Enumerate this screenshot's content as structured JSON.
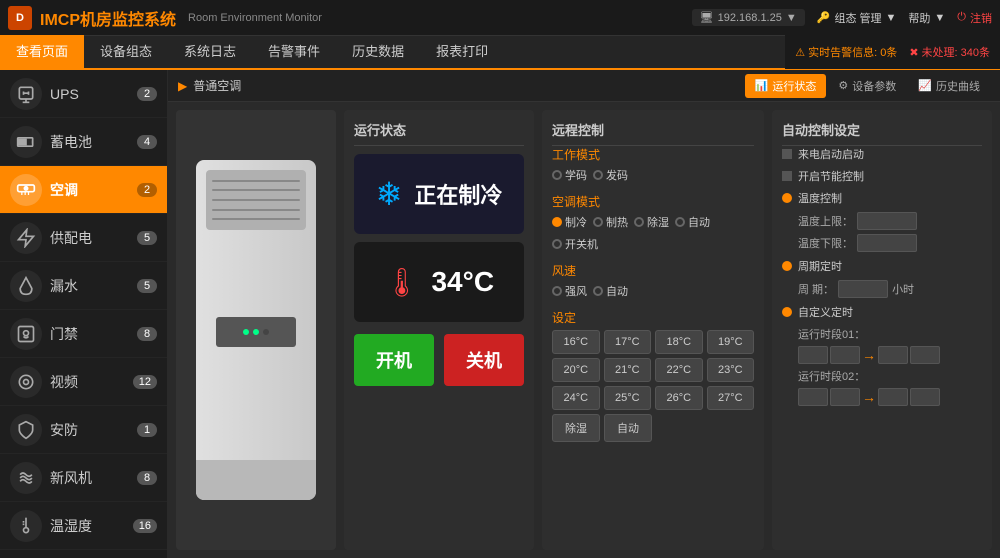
{
  "header": {
    "logo_icon": "D",
    "title": "IMCP机房监控系统",
    "subtitle": "Room Environment Monitor",
    "ip": "192.168.1.25",
    "org_btn": "组态 管理",
    "help_btn": "帮助",
    "logout_btn": "注销"
  },
  "navbar": {
    "items": [
      {
        "label": "查看页面",
        "active": true
      },
      {
        "label": "设备组态",
        "active": false
      },
      {
        "label": "系统日志",
        "active": false
      },
      {
        "label": "告警事件",
        "active": false
      },
      {
        "label": "历史数据",
        "active": false
      },
      {
        "label": "报表打印",
        "active": false
      }
    ],
    "alert_warn": "实时告警信息: 0条",
    "alert_error": "未处理: 340条"
  },
  "breadcrumb": {
    "arrow": "▶",
    "text": "普通空调",
    "tabs": [
      {
        "label": "运行状态",
        "active": true,
        "icon": "📊"
      },
      {
        "label": "设备参数",
        "active": false,
        "icon": "⚙"
      },
      {
        "label": "历史曲线",
        "active": false,
        "icon": "📈"
      }
    ]
  },
  "sidebar": {
    "items": [
      {
        "label": "UPS",
        "badge": "2",
        "active": false,
        "icon": "⚡"
      },
      {
        "label": "蓄电池",
        "badge": "4",
        "active": false,
        "icon": "🔋"
      },
      {
        "label": "空调",
        "badge": "2",
        "active": true,
        "icon": "❄"
      },
      {
        "label": "供配电",
        "badge": "5",
        "active": false,
        "icon": "⚡"
      },
      {
        "label": "漏水",
        "badge": "5",
        "active": false,
        "icon": "💧"
      },
      {
        "label": "门禁",
        "badge": "8",
        "active": false,
        "icon": "🚪"
      },
      {
        "label": "视频",
        "badge": "12",
        "active": false,
        "icon": "📷"
      },
      {
        "label": "安防",
        "badge": "1",
        "active": false,
        "icon": "🔒"
      },
      {
        "label": "新风机",
        "badge": "8",
        "active": false,
        "icon": "💨"
      },
      {
        "label": "温湿度",
        "badge": "16",
        "active": false,
        "icon": "🌡"
      }
    ]
  },
  "status": {
    "panel_title": "运行状态",
    "cooling_text": "正在制冷",
    "temp_value": "34°C",
    "btn_on": "开机",
    "btn_off": "关机"
  },
  "remote": {
    "panel_title": "远程控制",
    "work_mode_label": "工作模式",
    "work_modes": [
      "学码",
      "发码"
    ],
    "ac_mode_label": "空调模式",
    "ac_modes": [
      "制冷",
      "制热",
      "除湿",
      "自动",
      "开关机"
    ],
    "wind_label": "风速",
    "wind_modes": [
      "强风",
      "自动"
    ],
    "setting_label": "设定",
    "temp_buttons": [
      "16°C",
      "17°C",
      "18°C",
      "19°C",
      "20°C",
      "21°C",
      "22°C",
      "23°C",
      "24°C",
      "25°C",
      "26°C",
      "27°C"
    ],
    "special_buttons": [
      "除湿",
      "自动"
    ]
  },
  "auto_control": {
    "panel_title": "自动控制设定",
    "items": [
      {
        "type": "square",
        "label": "来电启动启动"
      },
      {
        "type": "square",
        "label": "开启节能控制"
      },
      {
        "type": "round",
        "label": "温度控制"
      },
      {
        "type": "round",
        "label": "周期定时"
      },
      {
        "type": "round",
        "label": "自定义定时"
      }
    ],
    "temp_upper_label": "温度上限：",
    "temp_lower_label": "温度下限：",
    "period_label": "周  期：",
    "period_unit": "小时",
    "run_period1_label": "运行时段01：",
    "run_period2_label": "运行时段02："
  }
}
